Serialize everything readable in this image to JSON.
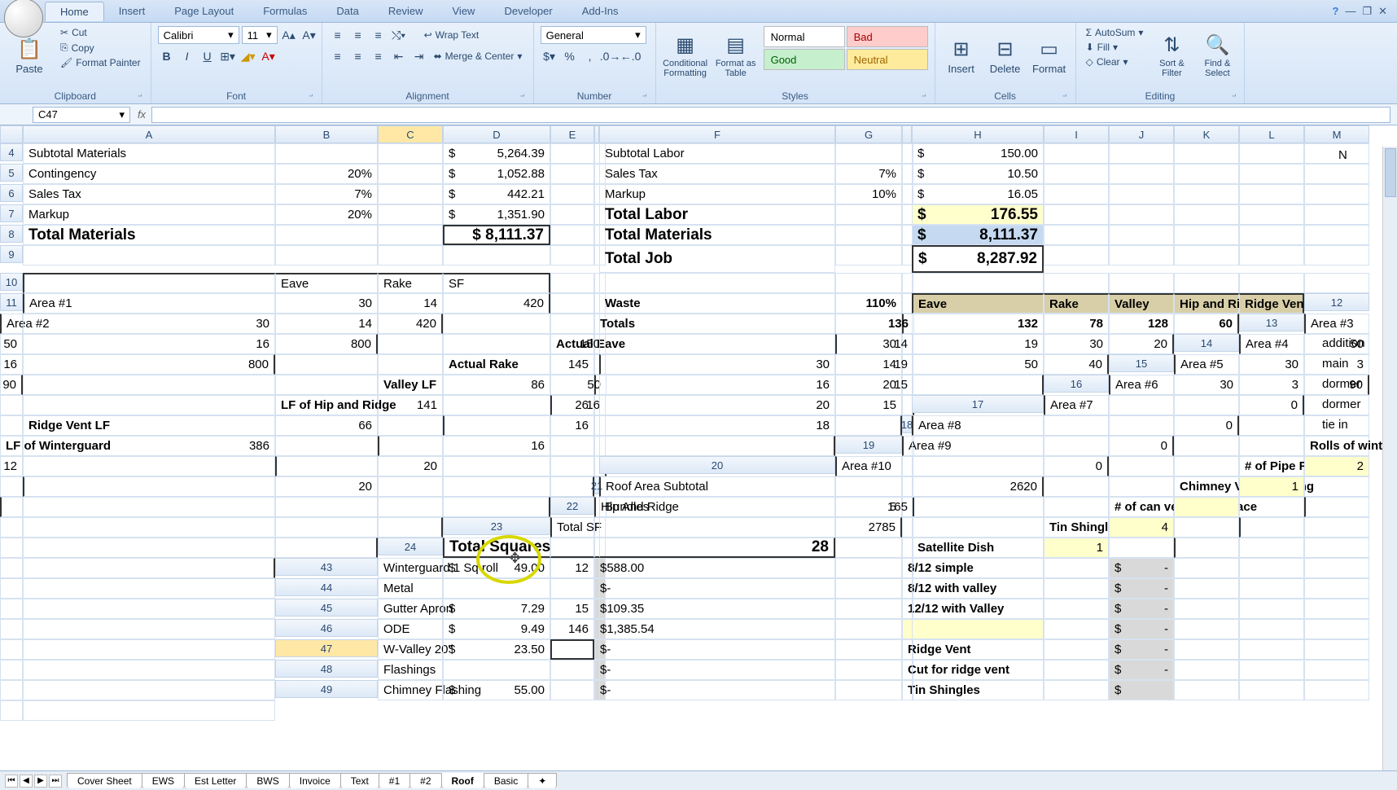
{
  "tabs": [
    "Home",
    "Insert",
    "Page Layout",
    "Formulas",
    "Data",
    "Review",
    "View",
    "Developer",
    "Add-Ins"
  ],
  "active_tab": "Home",
  "clipboard": {
    "cut": "Cut",
    "copy": "Copy",
    "format_painter": "Format Painter",
    "paste": "Paste",
    "group": "Clipboard"
  },
  "font": {
    "name": "Calibri",
    "size": "11",
    "group": "Font"
  },
  "alignment": {
    "wrap": "Wrap Text",
    "merge": "Merge & Center",
    "group": "Alignment"
  },
  "number": {
    "format": "General",
    "group": "Number"
  },
  "styles": {
    "cond": "Conditional Formatting",
    "table": "Format as Table",
    "normal": "Normal",
    "bad": "Bad",
    "good": "Good",
    "neutral": "Neutral",
    "group": "Styles"
  },
  "cells": {
    "insert": "Insert",
    "delete": "Delete",
    "format": "Format",
    "group": "Cells"
  },
  "editing": {
    "sum": "AutoSum",
    "fill": "Fill",
    "clear": "Clear",
    "sort": "Sort & Filter",
    "find": "Find & Select",
    "group": "Editing"
  },
  "namebox": "C47",
  "cols": [
    "A",
    "B",
    "C",
    "D",
    "E",
    "",
    "F",
    "G",
    "",
    "H",
    "I",
    "J",
    "K",
    "L",
    "M"
  ],
  "extra_col": "N",
  "rows_top": [
    {
      "n": 4,
      "a": "Subtotal Materials",
      "d_sym": "$",
      "d": "5,264.39",
      "f": "Subtotal Labor",
      "h_sym": "$",
      "h": "150.00"
    },
    {
      "n": 5,
      "a": "Contingency",
      "b": "20%",
      "d_sym": "$",
      "d": "1,052.88",
      "f": "Sales Tax",
      "g": "7%",
      "h_sym": "$",
      "h": "10.50"
    },
    {
      "n": 6,
      "a": "Sales Tax",
      "b": "7%",
      "d_sym": "$",
      "d": "442.21",
      "f": "Markup",
      "g": "10%",
      "h_sym": "$",
      "h": "16.05"
    },
    {
      "n": 7,
      "a": "Markup",
      "b": "20%",
      "d_sym": "$",
      "d": "1,351.90"
    }
  ],
  "totals": {
    "mat_label": "Total Materials",
    "mat_val": "$ 8,111.37",
    "lab_label": "Total Labor",
    "lab_sym": "$",
    "lab_val": "176.55",
    "mat2_label": "Total Materials",
    "mat2_sym": "$",
    "mat2_val": "8,111.37",
    "job_label": "Total Job",
    "job_sym": "$",
    "job_val": "8,287.92"
  },
  "area_hdr": {
    "b": "Eave",
    "c": "Rake",
    "d": "SF"
  },
  "areas": [
    {
      "n": 11,
      "a": "Area #1",
      "b": "30",
      "c": "14",
      "d": "420"
    },
    {
      "n": 12,
      "a": "Area #2",
      "b": "30",
      "c": "14",
      "d": "420"
    },
    {
      "n": 13,
      "a": "Area #3",
      "b": "50",
      "c": "16",
      "d": "800"
    },
    {
      "n": 14,
      "a": "Area #4",
      "b": "50",
      "c": "16",
      "d": "800"
    },
    {
      "n": 15,
      "a": "Area #5",
      "b": "30",
      "c": "3",
      "d": "90"
    },
    {
      "n": 16,
      "a": "Area #6",
      "b": "30",
      "c": "3",
      "d": "90"
    },
    {
      "n": 17,
      "a": "Area #7",
      "d": "0"
    },
    {
      "n": 18,
      "a": "Area #8",
      "d": "0"
    },
    {
      "n": 19,
      "a": "Area #9",
      "d": "0"
    },
    {
      "n": 20,
      "a": "Area #10",
      "d": "0"
    }
  ],
  "area_sub": {
    "n": 21,
    "a": "Roof Area Subtotal",
    "d": "2620"
  },
  "hip": {
    "n": 22,
    "a": "Hip And Ridge",
    "b": "Bundles",
    "c": "5",
    "d": "165"
  },
  "tsf": {
    "n": 23,
    "a": "Total SF",
    "d": "2785"
  },
  "tsq": {
    "n": 24,
    "a": "Total Squares",
    "d": "28"
  },
  "waste": {
    "label": "Waste",
    "pct": "110%"
  },
  "waste_hdr": {
    "h": "Eave",
    "i": "Rake",
    "j": "Valley",
    "k": "Hip and Ridge",
    "l": "Ridge Vent"
  },
  "waste_totals": {
    "label": "Totals",
    "h": "136",
    "i": "132",
    "j": "78",
    "k": "128",
    "l": "60"
  },
  "metrics": [
    {
      "n": 13,
      "f": "Actual Eave",
      "g": "150",
      "h": "30",
      "i": "14",
      "j": "19",
      "k": "30",
      "l": "20",
      "n2": "addition"
    },
    {
      "n": 14,
      "f": "Actual Rake",
      "g": "145",
      "h": "30",
      "i": "14",
      "j": "19",
      "k": "50",
      "l": "40",
      "n2": "main"
    },
    {
      "n": 15,
      "f": "Valley LF",
      "g": "86",
      "h": "50",
      "i": "16",
      "j": "20",
      "k": "15",
      "n2": "dormer"
    },
    {
      "n": 16,
      "f": "LF of Hip and Ridge",
      "g": "141",
      "h": "26",
      "i": "16",
      "j": "20",
      "k": "15",
      "n2": "dormer"
    },
    {
      "n": 17,
      "f": "Ridge Vent LF",
      "g": "66",
      "i": "16",
      "k": "18",
      "n2": "tie in"
    },
    {
      "n": 18,
      "f": "LF of Winterguard",
      "g": "386",
      "i": "16"
    },
    {
      "n": 19,
      "f": "Rolls of winterguard",
      "g": "12",
      "i": "20"
    },
    {
      "n": 20,
      "f": "# of Pipe Flashing",
      "g": "2",
      "i": "20",
      "gy": true
    },
    {
      "n": 21,
      "f": "Chimney Vent Flashing",
      "g": "1",
      "gy": true
    },
    {
      "n": 22,
      "f": "# of can vents to replace",
      "gy": true
    },
    {
      "n": 23,
      "f": "Tin Shingle areas",
      "g": "4",
      "gy": true
    },
    {
      "n": 24,
      "f": "Satellite Dish",
      "g": "1",
      "gy": true
    }
  ],
  "bottom": [
    {
      "n": 43,
      "a": "  Winterguard 1 Sq roll",
      "bs": "$",
      "b": "49.00",
      "c": "12",
      "ds": "$",
      "d": "588.00",
      "f": "8/12 simple",
      "hs": "$",
      "h": "-"
    },
    {
      "n": 44,
      "a": "Metal",
      "ds": "$",
      "d": "-",
      "f": "8/12 with valley",
      "hs": "$",
      "h": "-"
    },
    {
      "n": 45,
      "a": "  Gutter Apron",
      "bs": "$",
      "b": "7.29",
      "c": "15",
      "ds": "$",
      "d": "109.35",
      "f": "12/12 with Valley",
      "hs": "$",
      "h": "-"
    },
    {
      "n": 46,
      "a": "  ODE",
      "bs": "$",
      "b": "9.49",
      "c": "146",
      "ds": "$",
      "d": "1,385.54",
      "fy": true,
      "hs": "$",
      "h": "-"
    },
    {
      "n": 47,
      "a": "  W-Valley 20\"",
      "bs": "$",
      "b": "23.50",
      "active": true,
      "ds": "$",
      "d": "-",
      "f": "Ridge Vent",
      "hs": "$",
      "h": "-"
    },
    {
      "n": 48,
      "a": "Flashings",
      "ds": "$",
      "d": "-",
      "f": "Cut for ridge vent",
      "hs": "$",
      "h": "-"
    },
    {
      "n": 49,
      "a": "  Chimney Flashing",
      "bs": "$",
      "b": "55.00",
      "ds": "$",
      "d": "-",
      "f": "Tin Shingles",
      "hs": "$"
    }
  ],
  "sheets": [
    "Cover Sheet",
    "EWS",
    "Est Letter",
    "BWS",
    "Invoice",
    "Text",
    "#1",
    "#2",
    "Roof",
    "Basic"
  ],
  "active_sheet": "Roof"
}
